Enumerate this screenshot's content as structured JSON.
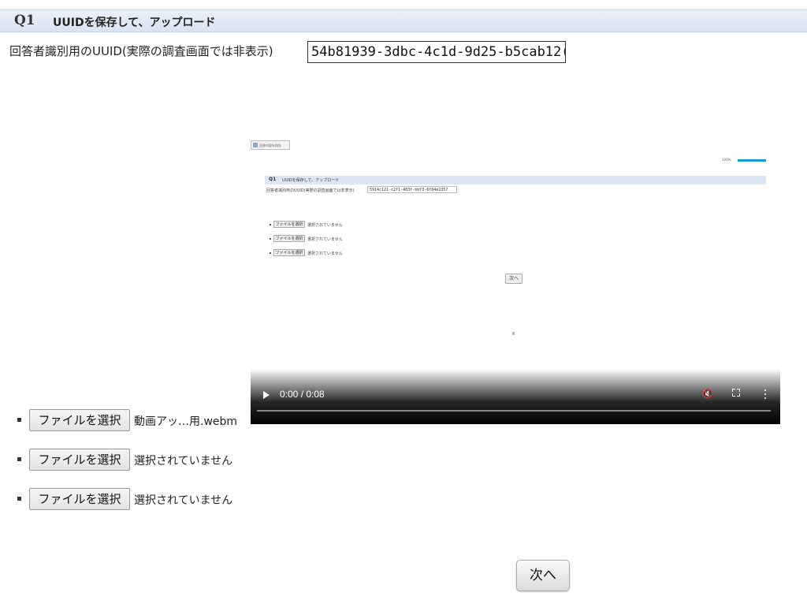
{
  "question": {
    "number": "Q1",
    "title": "UUIDを保存して、アップロード"
  },
  "uuid": {
    "label": "回答者識別用のUUID(実際の調査画面では非表示)",
    "value": "54b81939-3dbc-4c1d-9d25-b5cab12("
  },
  "file_inputs": [
    {
      "button_label": "ファイルを選択",
      "status": "動画アッ…用.webm"
    },
    {
      "button_label": "ファイルを選択",
      "status": "選択されていません"
    },
    {
      "button_label": "ファイルを選択",
      "status": "選択されていません"
    }
  ],
  "next_label": "次へ",
  "video": {
    "time": "0:00 / 0:08",
    "preview": {
      "top_button": "回答内容を保存",
      "percent": "100%",
      "progress": 1.0,
      "question_number": "Q1",
      "question_title": "UUIDを保存して、アップロード",
      "uuid_label": "回答者識別用のUUID(実際の調査画面では非表示)",
      "uuid_value": "5914c121-c2f1-483f-bbf3-6f84e2357",
      "file_inputs": [
        {
          "button_label": "ファイルを選択",
          "status": "選択されていません"
        },
        {
          "button_label": "ファイルを選択",
          "status": "選択されていません"
        },
        {
          "button_label": "ファイルを選択",
          "status": "選択されていません"
        }
      ],
      "next_label": "次へ"
    }
  },
  "icons": {
    "play": "play-icon",
    "mute": "volume-muted-icon",
    "fullscreen": "fullscreen-icon",
    "more": "more-vertical-icon"
  },
  "colors": {
    "question_bar": "#dde6f3",
    "progress_accent": "#1b9ad6"
  }
}
